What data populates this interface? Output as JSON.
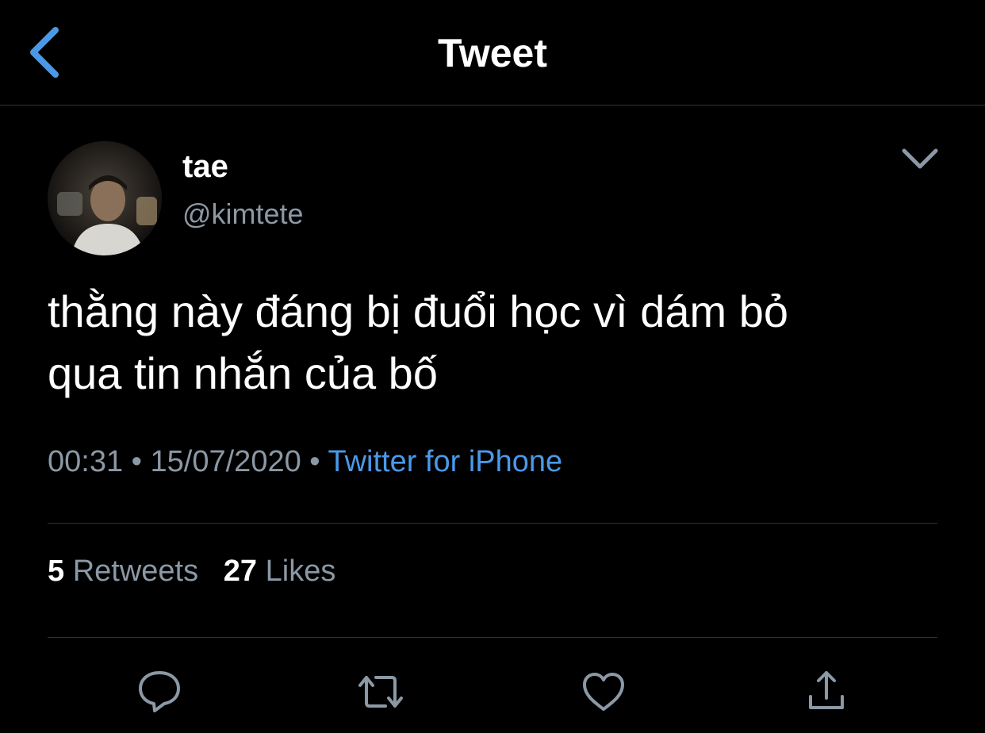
{
  "header": {
    "title": "Tweet",
    "back_icon": "chevron-left-icon"
  },
  "author": {
    "display_name": "tae",
    "handle": "@kimtete"
  },
  "tweet": {
    "text_line1": "thằng này đáng bị đuổi học vì dám bỏ",
    "text_line2": "qua tin nhắn của bố",
    "time": "00:31",
    "date": "15/07/2020",
    "separator": "•",
    "source": "Twitter for iPhone"
  },
  "stats": {
    "retweets_count": "5",
    "retweets_label": "Retweets",
    "likes_count": "27",
    "likes_label": "Likes"
  },
  "actions": [
    "reply-icon",
    "retweet-icon",
    "like-icon",
    "share-icon"
  ],
  "colors": {
    "background": "#000000",
    "accent": "#4a99e9",
    "secondary_text": "#8b98a5",
    "divider": "#2f3336"
  }
}
